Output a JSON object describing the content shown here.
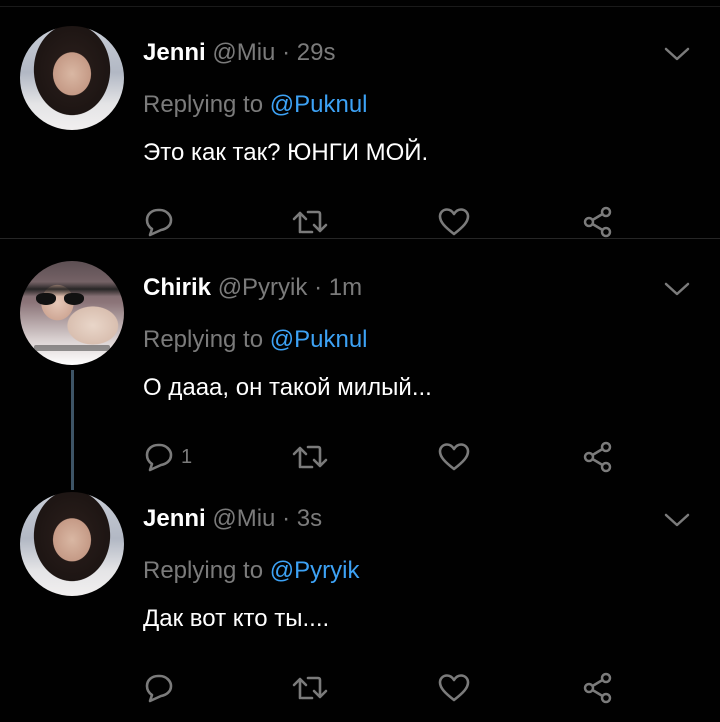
{
  "tweets": [
    {
      "author": "Jenni",
      "handle": "@Miu",
      "separator": "·",
      "time": "29s",
      "replying_prefix": "Replying to",
      "replying_to": "@Puknul",
      "text": "Это как так? ЮНГИ МОЙ.",
      "reply_count": ""
    },
    {
      "author": "Chirik",
      "handle": "@Pyryik",
      "separator": "·",
      "time": "1m",
      "replying_prefix": "Replying to",
      "replying_to": "@Puknul",
      "text": "О дааа, он такой милый...",
      "reply_count": "1"
    },
    {
      "author": "Jenni",
      "handle": "@Miu",
      "separator": "·",
      "time": "3s",
      "replying_prefix": "Replying to",
      "replying_to": "@Pyryik",
      "text": "Дак вот кто ты....",
      "reply_count": ""
    }
  ],
  "colors": {
    "background": "#010101",
    "secondary_text": "#7b7b7b",
    "mention": "#3da2f5",
    "thread_line": "#3d5466"
  },
  "icons": [
    "reply-icon",
    "retweet-icon",
    "like-icon",
    "share-icon",
    "chevron-down-icon"
  ]
}
